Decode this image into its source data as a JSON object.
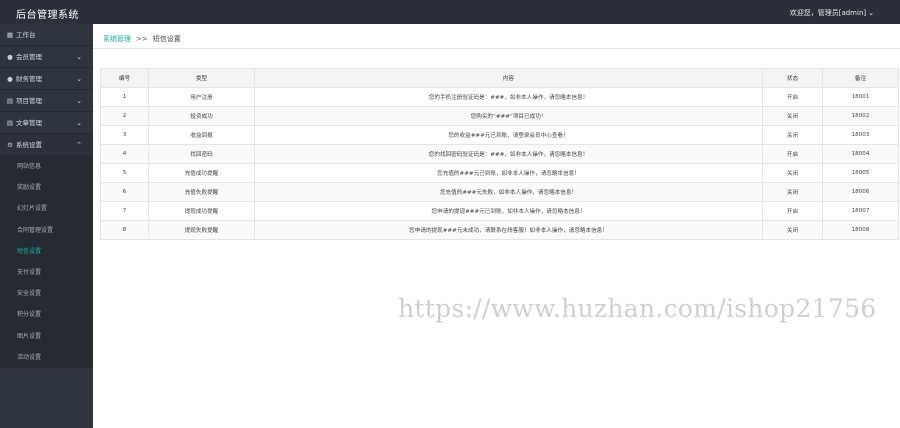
{
  "header": {
    "title": "后台管理系统",
    "user_text": "欢迎您，管理员[admin]",
    "dropdown_icon": "chevron-down"
  },
  "sidebar": {
    "items": [
      {
        "icon": "dashboard-icon",
        "glyph": "▦",
        "label": "工作台",
        "has_chevron": false
      },
      {
        "icon": "member-icon",
        "glyph": "●",
        "label": "会员管理",
        "has_chevron": true
      },
      {
        "icon": "finance-icon",
        "glyph": "●",
        "label": "财务管理",
        "has_chevron": true
      },
      {
        "icon": "project-icon",
        "glyph": "▤",
        "label": "项目管理",
        "has_chevron": true
      },
      {
        "icon": "article-icon",
        "glyph": "▤",
        "label": "文章管理",
        "has_chevron": true
      },
      {
        "icon": "settings-icon",
        "glyph": "⚙",
        "label": "系统设置",
        "has_chevron": true,
        "open": true
      }
    ],
    "sub_items": [
      {
        "label": "网站信息",
        "active": false
      },
      {
        "label": "奖励设置",
        "active": false
      },
      {
        "label": "幻灯片设置",
        "active": false
      },
      {
        "label": "合同管理设置",
        "active": false
      },
      {
        "label": "短信设置",
        "active": true
      },
      {
        "label": "支付设置",
        "active": false
      },
      {
        "label": "安全设置",
        "active": false
      },
      {
        "label": "积分设置",
        "active": false
      },
      {
        "label": "图片设置",
        "active": false
      },
      {
        "label": "活动设置",
        "active": false
      }
    ]
  },
  "breadcrumb": {
    "parent": "系统管理",
    "separator": ">>",
    "current": "短信设置"
  },
  "table": {
    "headers": [
      "编号",
      "类型",
      "内容",
      "状态",
      "备注"
    ],
    "rows": [
      {
        "id": "1",
        "type": "用户注册",
        "content": "您的手机注册验证码是：###，如非本人操作，请忽略本信息！",
        "status": "开启",
        "note": "18001"
      },
      {
        "id": "2",
        "type": "投资成功",
        "content": "您购买的“###”项目已成功！",
        "status": "关闭",
        "note": "18002"
      },
      {
        "id": "3",
        "type": "收益回报",
        "content": "您的收益###元已到账，请登录会员中心查看！",
        "status": "关闭",
        "note": "18003"
      },
      {
        "id": "4",
        "type": "找回密码",
        "content": "您的找回密码验证码是：###，如非本人操作，请忽略本信息！",
        "status": "开启",
        "note": "18004"
      },
      {
        "id": "5",
        "type": "充值成功提醒",
        "content": "您充值的###元已到账，如非本人操作，请忽略本信息！",
        "status": "关闭",
        "note": "18005"
      },
      {
        "id": "6",
        "type": "充值失败提醒",
        "content": "您充值的###元失败，如非本人操作，请忽略本信息！",
        "status": "关闭",
        "note": "18006"
      },
      {
        "id": "7",
        "type": "提现成功提醒",
        "content": "您申请的提现###元已到账，如非本人操作，请忽略本信息！",
        "status": "开启",
        "note": "18007"
      },
      {
        "id": "8",
        "type": "提现失败提醒",
        "content": "您申请的提现###元未成功，请联系在线客服！如非本人操作，请忽略本信息！",
        "status": "关闭",
        "note": "18008"
      }
    ]
  },
  "watermark": "https://www.huzhan.com/ishop21756",
  "colors": {
    "topbar": "#2b2f3a",
    "sidebar": "#2f3441",
    "accent": "#1aa69a"
  }
}
